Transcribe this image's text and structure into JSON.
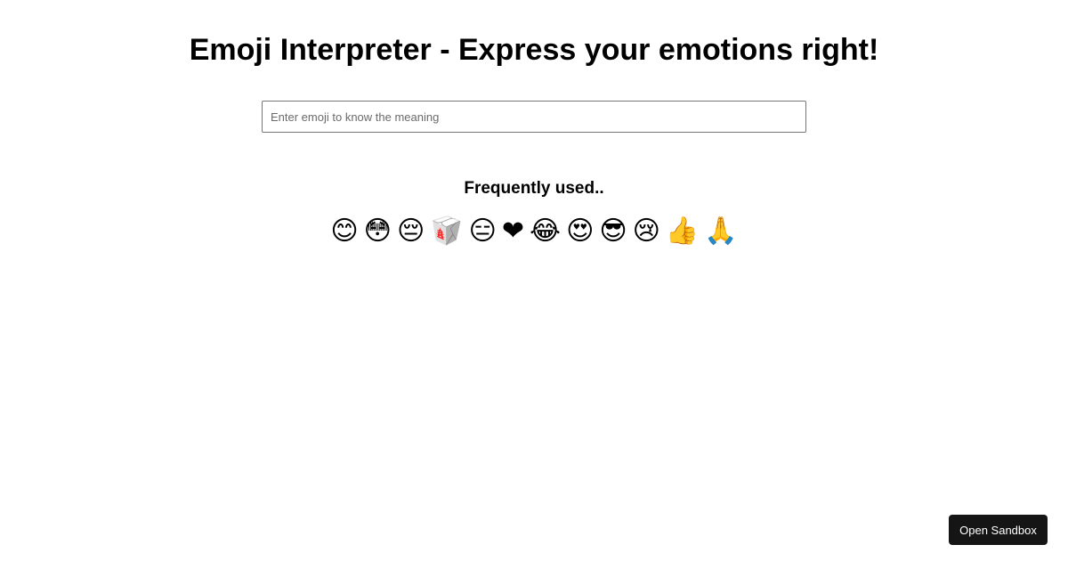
{
  "header": {
    "title": "Emoji Interpreter - Express your emotions right!"
  },
  "search": {
    "placeholder": "Enter emoji to know the meaning",
    "value": ""
  },
  "frequently_used": {
    "heading": "Frequently used..",
    "emojis": [
      "😊",
      "😳",
      "😔",
      "🥡",
      "😑",
      "❤",
      "😂",
      "😍",
      "😎",
      "😢",
      "👍",
      "🙏"
    ]
  },
  "footer": {
    "open_sandbox_label": "Open Sandbox"
  },
  "colors": {
    "background": "#ffffff",
    "text": "#000000",
    "input_border": "#767676",
    "sandbox_button_bg": "#151515",
    "sandbox_button_text": "#ffffff"
  }
}
